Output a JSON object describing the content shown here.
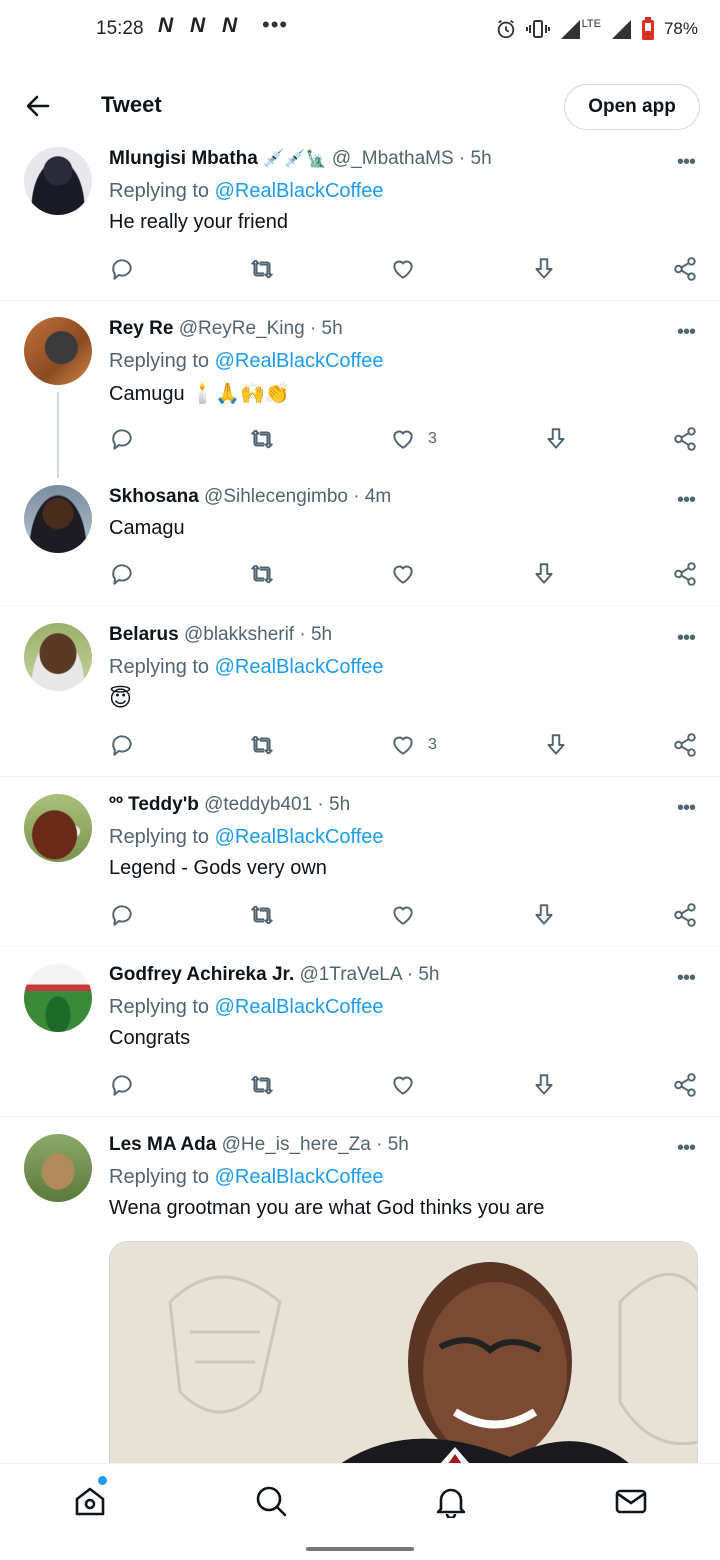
{
  "status_bar": {
    "time": "15:28",
    "notif_icons": [
      "N",
      "N",
      "N"
    ],
    "more": "•••",
    "network": "LTE",
    "battery": "78%",
    "icons": [
      "alarm-icon",
      "vibrate-icon",
      "signal-icon",
      "battery-icon"
    ]
  },
  "header": {
    "title": "Tweet",
    "open_app": "Open app"
  },
  "reply_prefix": "Replying to ",
  "tweets": [
    {
      "name": "Mlungisi Mbatha",
      "name_emoji": "💉💉🗽",
      "handle": "@_MbathaMS · 5h",
      "reply_to": "@RealBlackCoffee",
      "text": "He really your friend",
      "likes": ""
    },
    {
      "name": "Rey Re",
      "name_emoji": "",
      "handle": "@ReyRe_King · 5h",
      "reply_to": "@RealBlackCoffee",
      "text": "Camugu 🕯️🙏🙌👏",
      "likes": "3"
    },
    {
      "name": "Skhosana",
      "name_emoji": "",
      "handle": "@Sihlecengimbo · 4m",
      "reply_to": "",
      "text": "Camagu",
      "likes": ""
    },
    {
      "name": "Belarus",
      "name_emoji": "",
      "handle": "@blakksherif · 5h",
      "reply_to": "@RealBlackCoffee",
      "text": "😇",
      "likes": "3"
    },
    {
      "name": "ºº Teddy'b",
      "name_emoji": "",
      "handle": "@teddyb401 · 5h",
      "reply_to": "@RealBlackCoffee",
      "text": "Legend - Gods very own",
      "likes": ""
    },
    {
      "name": "Godfrey Achireka Jr.",
      "name_emoji": "",
      "handle": "@1TraVeLA · 5h",
      "reply_to": "@RealBlackCoffee",
      "text": "Congrats",
      "likes": ""
    },
    {
      "name": "Les MA Ada",
      "name_emoji": "",
      "handle": "@He_is_here_Za · 5h",
      "reply_to": "@RealBlackCoffee",
      "text": "Wena grootman you are what God thinks you are",
      "likes": ""
    }
  ],
  "more_label": "•••",
  "bottom_nav": [
    "home-icon",
    "search-icon",
    "notifications-icon",
    "messages-icon"
  ],
  "colors": {
    "accent": "#1d9bf0",
    "text": "#0f1419",
    "muted": "#536471",
    "divider": "#eff3f4"
  }
}
